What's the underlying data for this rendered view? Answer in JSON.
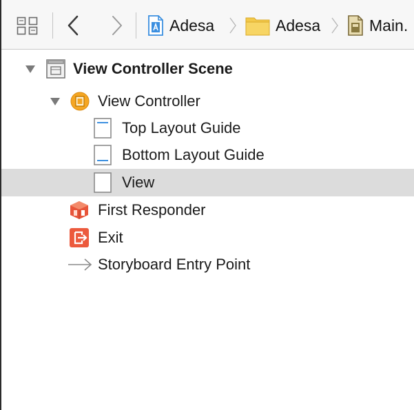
{
  "jumpbar": {
    "breadcrumbs": [
      {
        "label": "Adesa",
        "icon": "xcode-project-icon"
      },
      {
        "label": "Adesa",
        "icon": "folder-icon"
      },
      {
        "label": "Main.",
        "icon": "storyboard-file-icon"
      }
    ]
  },
  "outline": {
    "items": [
      {
        "label": "View Controller Scene",
        "icon": "scene-icon",
        "expanded": true
      },
      {
        "label": "View Controller",
        "icon": "view-controller-icon",
        "expanded": true
      },
      {
        "label": "Top Layout Guide",
        "icon": "top-layout-guide-icon"
      },
      {
        "label": "Bottom Layout Guide",
        "icon": "bottom-layout-guide-icon"
      },
      {
        "label": "View",
        "icon": "view-icon",
        "selected": true
      },
      {
        "label": "First Responder",
        "icon": "first-responder-icon"
      },
      {
        "label": "Exit",
        "icon": "exit-icon"
      },
      {
        "label": "Storyboard Entry Point",
        "icon": "entry-point-arrow-icon"
      }
    ]
  },
  "colors": {
    "selection": "#dcdcdc",
    "project_blue": "#3b8fe0",
    "folder_yellow": "#f3c94a",
    "view_controller_orange": "#f5a623",
    "first_responder_red": "#e8553a",
    "exit_red": "#ec5a3d"
  }
}
